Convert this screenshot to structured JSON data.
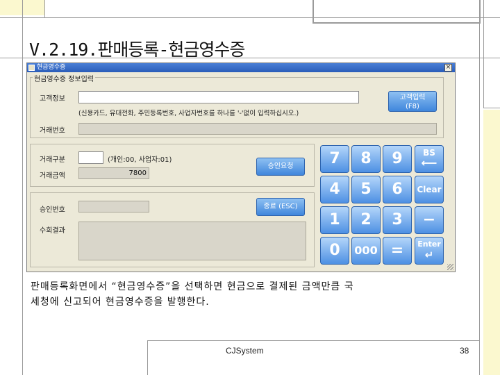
{
  "slide": {
    "title": "V.2.19.판매등록-현금영수증",
    "body_line1": "판매등록화면에서 “현금영수증”을 선택하면 현금으로 결제된 금액만큼 국",
    "body_line2": "세청에 신고되어 현금영수증을 발행한다.",
    "footer_left": "CJSystem",
    "page_number": "38"
  },
  "window": {
    "title": "현금영수증",
    "close_symbol": "×",
    "group_info_title": "현금영수증 정보입력",
    "customer_info_label": "고객정보",
    "customer_info_value": "",
    "customer_hint": "(신용카드, 유대전화, 주민등록번호, 사업자번호를 하나를 '-'없이 입력하십시오.)",
    "customer_input_button_line1": "고객입력",
    "customer_input_button_line2": "(F8)",
    "transaction_no_label": "거래번호",
    "transaction_no_value": "",
    "transaction_type_label": "거래구분",
    "transaction_type_value": "",
    "transaction_type_hint": "(개인:00, 사업자:01)",
    "transaction_amount_label": "거래금액",
    "transaction_amount_value": "7800",
    "approve_button": "승인요청",
    "approval_no_label": "승인번호",
    "approval_no_value": "",
    "exit_button": "종료 (ESC)",
    "response_label": "수회결과",
    "response_value": ""
  },
  "keypad": {
    "k7": "7",
    "k8": "8",
    "k9": "9",
    "bs": "BS",
    "bs_arrow": "⟵",
    "k4": "4",
    "k5": "5",
    "k6": "6",
    "clear": "Clear",
    "k1": "1",
    "k2": "2",
    "k3": "3",
    "minus": "−",
    "k0": "0",
    "k000": "000",
    "equals": "=",
    "enter": "Enter",
    "enter_arrow": "↵"
  },
  "colors": {
    "window_bg": "#ece9d8",
    "titlebar": "#2a5cb8",
    "button": "#3f86dc",
    "key": "#4d90e3",
    "deco_yellow": "#fbf8cf",
    "deco_line": "#999999"
  }
}
